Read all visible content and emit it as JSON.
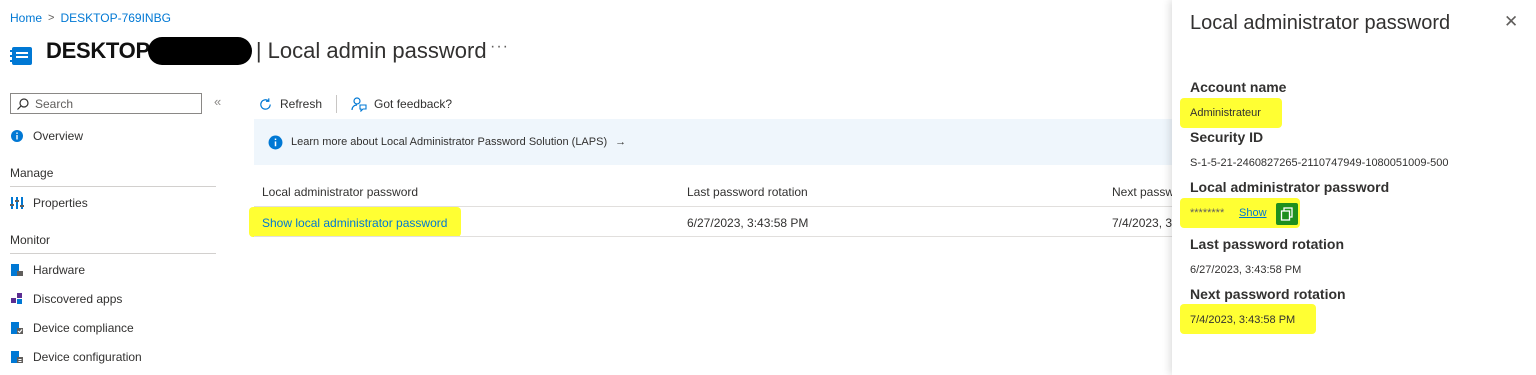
{
  "breadcrumb": {
    "home": "Home",
    "sep": ">",
    "device": "DESKTOP-769INBG"
  },
  "title": {
    "main": "DESKTOP",
    "sub": "| Local admin password",
    "more": "···"
  },
  "sidebar": {
    "search_placeholder": "Search",
    "collapse": "«",
    "overview": "Overview",
    "manage_header": "Manage",
    "properties": "Properties",
    "monitor_header": "Monitor",
    "hardware": "Hardware",
    "discovered_apps": "Discovered apps",
    "device_compliance": "Device compliance",
    "device_configuration": "Device configuration"
  },
  "toolbar": {
    "refresh": "Refresh",
    "feedback": "Got feedback?"
  },
  "banner": {
    "text": "Learn more about Local Administrator Password Solution (LAPS)",
    "arrow": "→"
  },
  "table": {
    "columns": [
      "Local administrator password",
      "Last password rotation",
      "Next passw"
    ],
    "row": [
      "Show local administrator password",
      "6/27/2023, 3:43:58 PM",
      "7/4/2023, 3"
    ]
  },
  "panel": {
    "title": "Local administrator password",
    "close": "✕",
    "account_label": "Account name",
    "account_value": "Administrateur",
    "sid_label": "Security ID",
    "sid_value": "S-1-5-21-2460827265-2110747949-1080051009-500",
    "password_label": "Local administrator password",
    "password_mask": "********",
    "show": "Show",
    "last_label": "Last password rotation",
    "last_value": "6/27/2023, 3:43:58 PM",
    "next_label": "Next password rotation",
    "next_value": "7/4/2023, 3:43:58 PM"
  },
  "colors": {
    "accent": "#0078d4",
    "highlight": "#ffff33",
    "copy_button": "#1e8f1e",
    "banner_bg": "#eff6fc"
  }
}
